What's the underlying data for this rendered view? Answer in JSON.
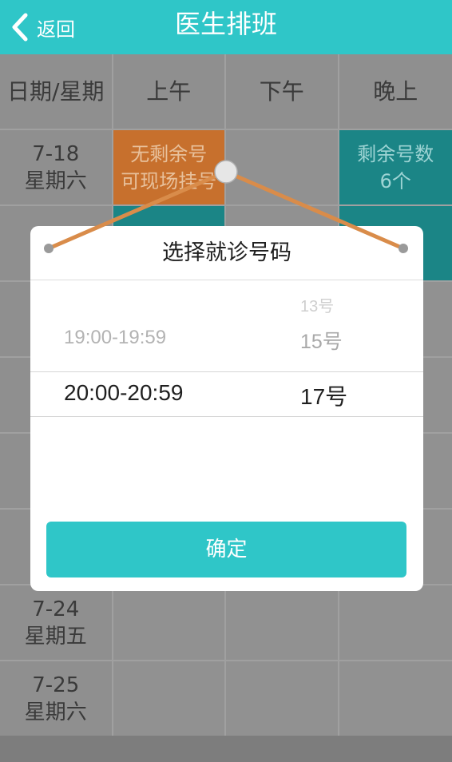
{
  "header": {
    "back_label": "返回",
    "title": "医生排班"
  },
  "schedule": {
    "columns": [
      "日期/星期",
      "上午",
      "下午",
      "晚上"
    ],
    "rows": [
      {
        "date": "7-18",
        "weekday": "星期六",
        "morning": [
          "无剩余号",
          "可现场挂号"
        ],
        "evening": [
          "剩余号数",
          "6个"
        ]
      },
      {
        "date": "7-24",
        "weekday": "星期五"
      },
      {
        "date": "7-25",
        "weekday": "星期六"
      }
    ]
  },
  "dialog": {
    "title": "选择就诊号码",
    "time_options": [
      "19:00-19:59",
      "20:00-20:59"
    ],
    "number_options": [
      "13号",
      "15号",
      "17号"
    ],
    "selected_time": "20:00-20:59",
    "selected_number": "17号",
    "confirm_label": "确定"
  },
  "colors": {
    "accent": "#2fc6c8",
    "orange_cell": "#c7702d",
    "teal_cell": "#1b8586"
  }
}
